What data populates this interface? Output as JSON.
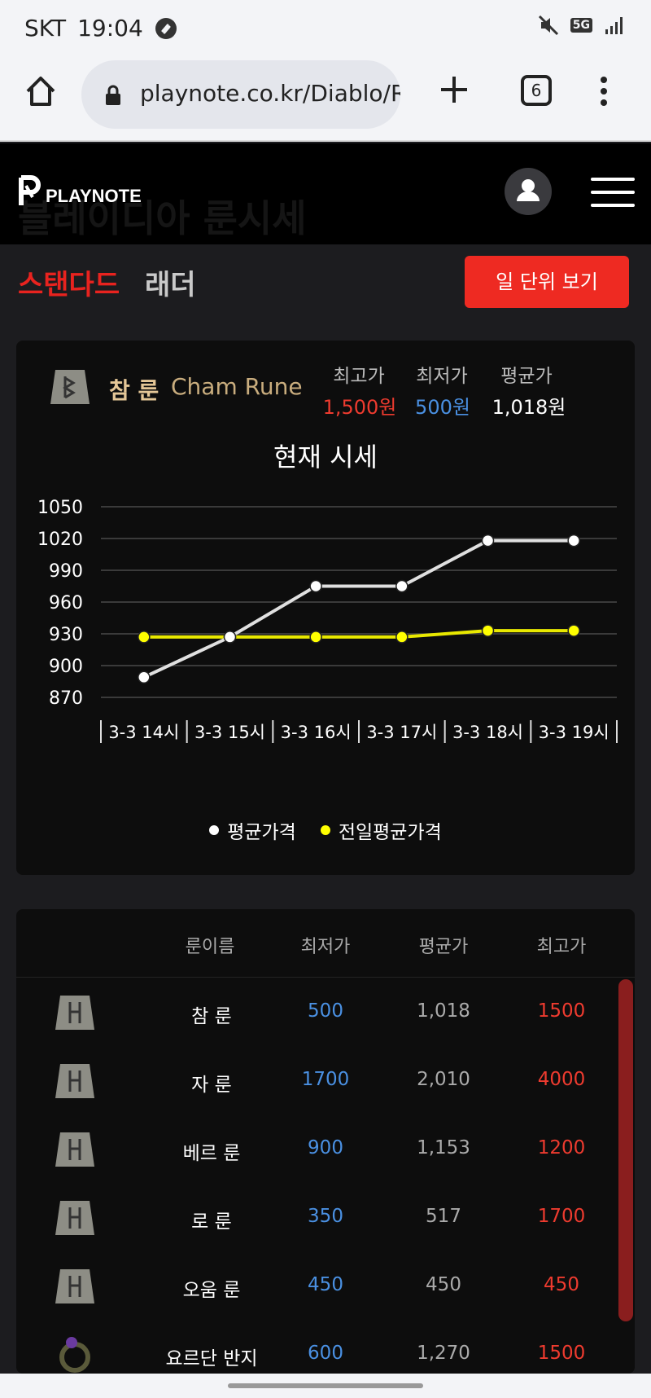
{
  "status": {
    "carrier": "SKT",
    "time": "19:04",
    "network": "5G"
  },
  "browser": {
    "url": "playnote.co.kr/Diablo/Ru",
    "tab_count": "6"
  },
  "site": {
    "logo": "PLAYNOTE",
    "ghost_title": "블레이디아 룬시세"
  },
  "tabs": {
    "standard": "스탠다드",
    "ladder": "래더",
    "day_view": "일 단위 보기"
  },
  "rune": {
    "name_ko": "참 룬",
    "name_en": "Cham Rune",
    "labels": {
      "max": "최고가",
      "min": "최저가",
      "avg": "평균가"
    },
    "max_price": "1,500원",
    "min_price": "500원",
    "avg_price": "1,018원"
  },
  "chart_title": "현재 시세",
  "chart_data": {
    "type": "line",
    "categories": [
      "3-3 14시",
      "3-3 15시",
      "3-3 16시",
      "3-3 17시",
      "3-3 18시",
      "3-3 19시"
    ],
    "series": [
      {
        "name": "평균가격",
        "color": "#ffffff",
        "values": [
          889,
          927,
          975,
          975,
          1018,
          1018
        ]
      },
      {
        "name": "전일평균가격",
        "color": "#ffff00",
        "values": [
          927,
          927,
          927,
          927,
          933,
          933
        ]
      }
    ],
    "yticks": [
      1050,
      1020,
      990,
      960,
      930,
      900,
      870
    ],
    "ylim": [
      870,
      1050
    ]
  },
  "table": {
    "headers": {
      "name": "룬이름",
      "min": "최저가",
      "avg": "평균가",
      "max": "최고가"
    },
    "rows": [
      {
        "name": "참 룬",
        "min": "500",
        "avg": "1,018",
        "max": "1500"
      },
      {
        "name": "자 룬",
        "min": "1700",
        "avg": "2,010",
        "max": "4000"
      },
      {
        "name": "베르 룬",
        "min": "900",
        "avg": "1,153",
        "max": "1200"
      },
      {
        "name": "로 룬",
        "min": "350",
        "avg": "517",
        "max": "1700"
      },
      {
        "name": "오움 룬",
        "min": "450",
        "avg": "450",
        "max": "450"
      },
      {
        "name": "요르단 반지",
        "min": "600",
        "avg": "1,270",
        "max": "1500"
      }
    ]
  },
  "colors": {
    "accent": "#ee2a22",
    "min_blue": "#4a90e2",
    "max_red": "#ee3b2f"
  }
}
